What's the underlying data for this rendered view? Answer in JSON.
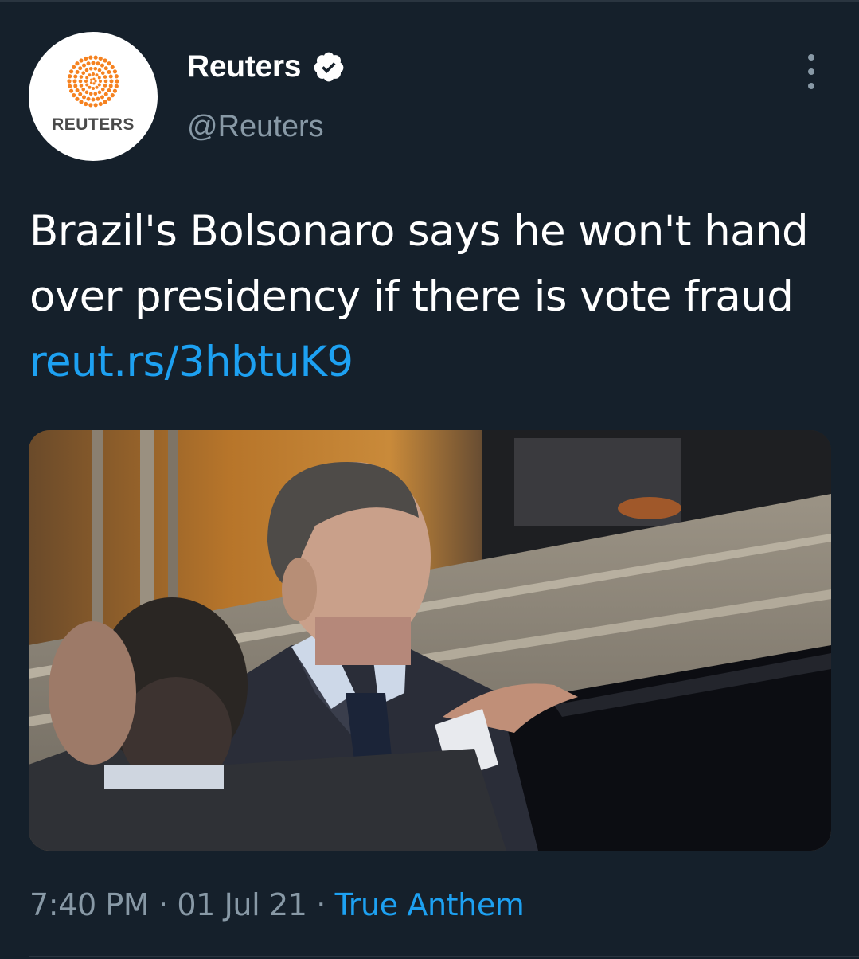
{
  "account": {
    "display_name": "Reuters",
    "handle": "@Reuters",
    "avatar_text": "REUTERS",
    "verified": true
  },
  "tweet": {
    "text": "Brazil's Bolsonaro says he won't hand over presidency if there is vote fraud",
    "link": "reut.rs/3hbtuK9",
    "time": "7:40 PM",
    "date": "01 Jul 21",
    "separator": "·",
    "source": "True Anthem"
  },
  "icons": {
    "verified": "verified-badge-icon",
    "more": "more-options-icon"
  },
  "colors": {
    "background": "#15202b",
    "link": "#1da1f2",
    "secondary_text": "#8899a6",
    "reuters_orange": "#f58220"
  }
}
